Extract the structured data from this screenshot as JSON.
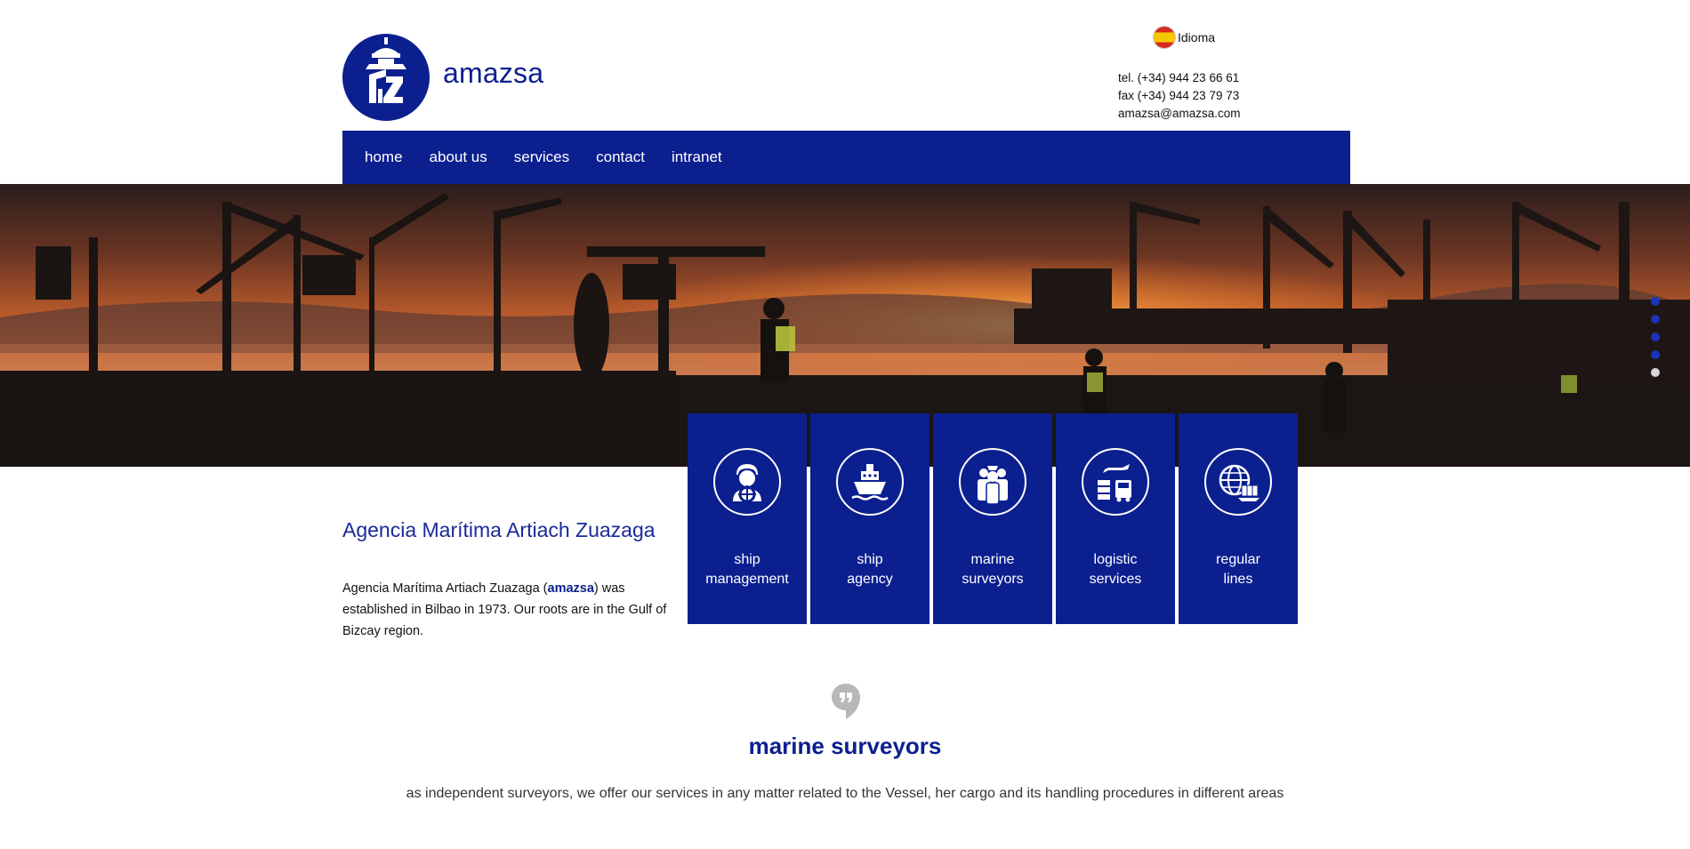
{
  "header": {
    "logo_text": "amazsa",
    "language_label": "Idioma",
    "contact": {
      "tel": "tel. (+34) 944 23 66 61",
      "fax": "fax (+34) 944 23 79 73",
      "email": "amazsa@amazsa.com"
    }
  },
  "nav": {
    "items": [
      {
        "label": "home"
      },
      {
        "label": "about us"
      },
      {
        "label": "services"
      },
      {
        "label": "contact"
      },
      {
        "label": "intranet"
      }
    ]
  },
  "slider": {
    "slide_count": 5,
    "active_index": 4
  },
  "services": [
    {
      "line1": "ship",
      "line2": "management",
      "icon": "captain-icon"
    },
    {
      "line1": "ship",
      "line2": "agency",
      "icon": "ship-icon"
    },
    {
      "line1": "marine",
      "line2": "surveyors",
      "icon": "surveyors-icon"
    },
    {
      "line1": "logistic",
      "line2": "services",
      "icon": "logistics-icon"
    },
    {
      "line1": "regular",
      "line2": "lines",
      "icon": "globe-icon"
    }
  ],
  "intro": {
    "title": "Agencia Marítima Artiach Zuazaga",
    "text_before": "Agencia Marítima Artiach Zuazaga (",
    "brand": "amazsa",
    "text_after": ") was established in Bilbao in 1973. Our roots are in the Gulf of Bizcay region."
  },
  "featured": {
    "title": "marine surveyors",
    "text": "as independent surveyors, we offer our services in any matter related to the Vessel, her cargo and its handling procedures in different areas"
  },
  "colors": {
    "brand_blue": "#0c1f8f",
    "hero_sunset": "#f07a30",
    "dot_inactive": "#1d33b8",
    "dot_active": "#d6d6d6"
  }
}
